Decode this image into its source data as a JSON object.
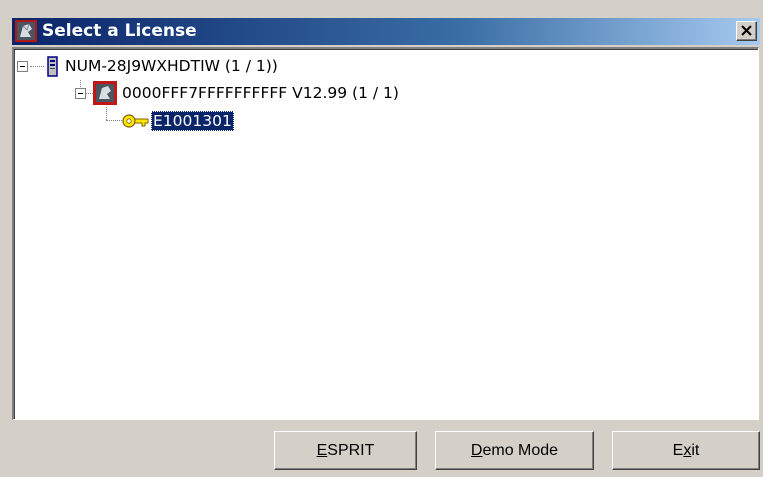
{
  "window": {
    "title": "Select a License",
    "close_label": "×",
    "accent_color": "#0a246a",
    "icon": "app-icon"
  },
  "tree": {
    "nodes": [
      {
        "label": "NUM-28J9WXHDTIW (1 / 1))",
        "icon": "server-icon",
        "expanded": true
      },
      {
        "label": "0000FFF7FFFFFFFFFF V12.99 (1 / 1)",
        "icon": "app-icon",
        "expanded": true
      },
      {
        "label": "E1001301",
        "icon": "key-icon",
        "selected": true
      }
    ]
  },
  "buttons": {
    "esprit": {
      "mnemonic": "E",
      "rest": "SPRIT"
    },
    "demo": {
      "mnemonic": "D",
      "rest": "emo Mode"
    },
    "exit": {
      "pre": "E",
      "mnemonic": "x",
      "rest": "it"
    }
  }
}
